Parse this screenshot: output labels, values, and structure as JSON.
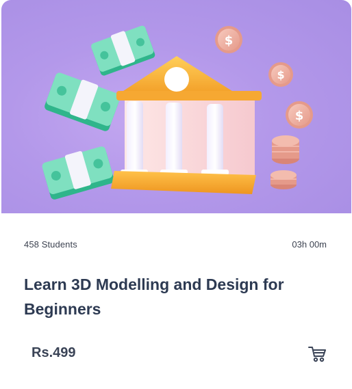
{
  "course": {
    "students": "458 Students",
    "duration": "03h 00m",
    "title": "Learn 3D Modelling and Design for Beginners",
    "price": "Rs.499"
  },
  "icons": {
    "cart": "shopping-cart-icon",
    "hero": "bank-with-money-illustration"
  },
  "colors": {
    "hero_background": "#b398ea",
    "title": "#2d3a52",
    "text": "#3c4250"
  }
}
